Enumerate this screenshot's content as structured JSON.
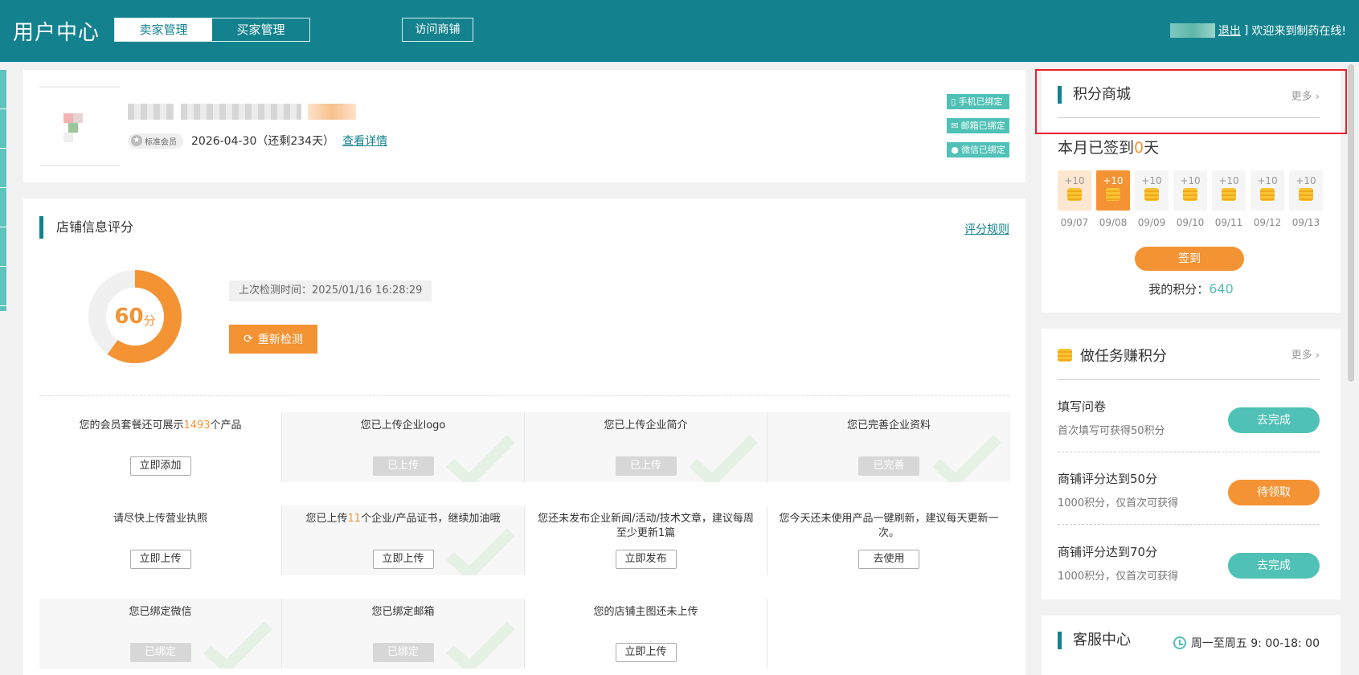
{
  "header": {
    "title": "用户中心",
    "tabs": [
      {
        "label": "卖家管理",
        "active": true
      },
      {
        "label": "买家管理",
        "active": false
      }
    ],
    "visit_shop": "访问商铺",
    "logout": "退出",
    "bracket": "]",
    "welcome": "欢迎来到制药在线!"
  },
  "profile": {
    "member_level": "标准会员",
    "expiry": "2026-04-30（还剩234天）",
    "detail_link": "查看详情",
    "bindings": [
      {
        "icon": "phone-icon",
        "label": "手机已绑定"
      },
      {
        "icon": "mail-icon",
        "label": "邮箱已绑定"
      },
      {
        "icon": "wechat-icon",
        "label": "微信已绑定"
      }
    ]
  },
  "score": {
    "title": "店铺信息评分",
    "rules": "评分规则",
    "value": 60,
    "unit": "分",
    "value_percent": 60,
    "check_time": "上次检测时间：2025/01/16 16:28:29",
    "recheck": "重新检测",
    "tasks": {
      "r0": {
        "t0_pre": "您的会员套餐还可展示",
        "t0_hl": "1493",
        "t0_post": "个产品",
        "t0_btn": "立即添加",
        "t1": "您已上传企业logo",
        "t1_btn": "已上传",
        "t2": "您已上传企业简介",
        "t2_btn": "已上传",
        "t3": "您已完善企业资料",
        "t3_btn": "已完善"
      },
      "r1": {
        "t0": "请尽快上传营业执照",
        "t0_btn": "立即上传",
        "t1_pre": "您已上传",
        "t1_hl": "11",
        "t1_post": "个企业/产品证书，继续加油哦",
        "t1_btn": "立即上传",
        "t2": "您还未发布企业新闻/活动/技术文章，建议每周至少更新1篇",
        "t2_btn": "立即发布",
        "t3": "您今天还未使用产品一键刷新，建议每天更新一次。",
        "t3_btn": "去使用"
      },
      "r2": {
        "t0": "您已绑定微信",
        "t0_btn": "已绑定",
        "t1": "您已绑定邮箱",
        "t1_btn": "已绑定",
        "t2": "您的店铺主图还未上传",
        "t2_btn": "立即上传"
      }
    }
  },
  "mall": {
    "title": "积分商城",
    "more": "更多",
    "signed_pre": "本月已签到",
    "signed_days": "0",
    "signed_post": "天",
    "days": [
      {
        "bonus": "+10",
        "date": "09/07"
      },
      {
        "bonus": "+10",
        "date": "09/08"
      },
      {
        "bonus": "+10",
        "date": "09/09"
      },
      {
        "bonus": "+10",
        "date": "09/10"
      },
      {
        "bonus": "+10",
        "date": "09/11"
      },
      {
        "bonus": "+10",
        "date": "09/12"
      },
      {
        "bonus": "+10",
        "date": "09/13"
      }
    ],
    "sign_btn": "签到",
    "my_points_label": "我的积分：",
    "my_points": "640"
  },
  "earn": {
    "title": "做任务赚积分",
    "more": "更多",
    "items": [
      {
        "title": "填写问卷",
        "desc": "首次填写可获得50积分",
        "btn": "去完成"
      },
      {
        "title": "商铺评分达到50分",
        "desc": "1000积分，仅首次可获得",
        "btn": "待领取"
      },
      {
        "title": "商铺评分达到70分",
        "desc": "1000积分，仅首次可获得",
        "btn": "去完成"
      }
    ]
  },
  "service": {
    "title": "客服中心",
    "hours": "周一至周五 9: 00-18: 00"
  },
  "colors": {
    "teal": "#13828e",
    "accent_teal": "#4fc1b6",
    "orange": "#f39334",
    "highlight_red": "#e8202a"
  }
}
